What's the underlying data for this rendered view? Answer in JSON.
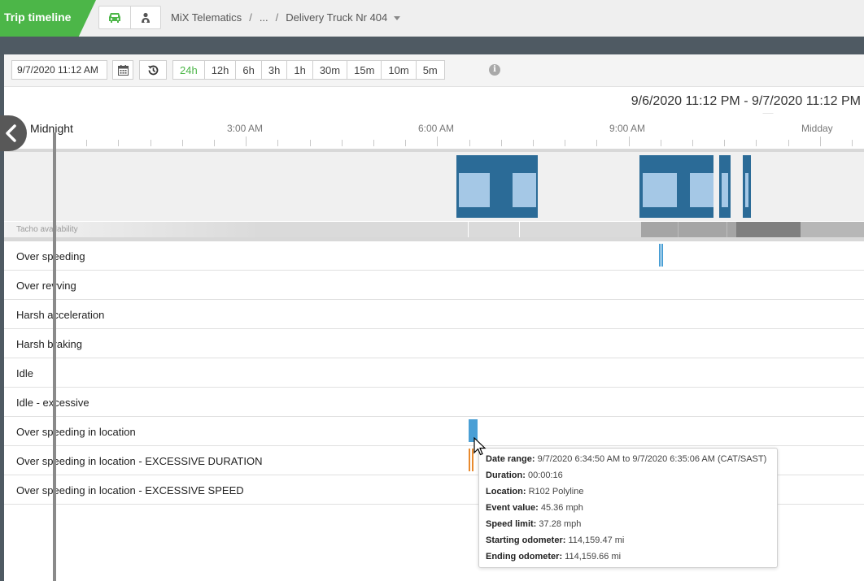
{
  "header": {
    "title": "Trip timeline",
    "modes": [
      {
        "icon": "vehicle-icon",
        "color": "#4cb648"
      },
      {
        "icon": "driver-icon",
        "color": "#555555"
      }
    ],
    "breadcrumb": [
      "MiX Telematics",
      "...",
      "Delivery Truck Nr 404"
    ]
  },
  "toolbar": {
    "date_value": "9/7/2020 11:12 AM",
    "ranges": [
      "24h",
      "12h",
      "6h",
      "3h",
      "1h",
      "30m",
      "15m",
      "10m",
      "5m"
    ],
    "active_range": "24h"
  },
  "range_label": "9/6/2020 11:12 PM  -  9/7/2020 11:12 PM",
  "axis": {
    "start_label": "Midnight",
    "labels": [
      "3:00 AM",
      "6:00 AM",
      "9:00 AM",
      "Midday"
    ]
  },
  "tacho": {
    "label": "Tacho availability"
  },
  "events": {
    "rows": [
      "Over speeding",
      "Over revving",
      "Harsh acceleration",
      "Harsh braking",
      "Idle",
      "Idle - excessive",
      "Over speeding in location",
      "Over speeding in location - EXCESSIVE DURATION",
      "Over speeding in location - EXCESSIVE SPEED"
    ]
  },
  "tooltip": {
    "date_range_label": "Date range:",
    "date_range_value": "9/7/2020 6:34:50 AM to 9/7/2020 6:35:06 AM (CAT/SAST)",
    "duration_label": "Duration:",
    "duration_value": "00:00:16",
    "location_label": "Location:",
    "location_value": "R102 Polyline",
    "event_value_label": "Event value:",
    "event_value_value": "45.36 mph",
    "speed_limit_label": "Speed limit:",
    "speed_limit_value": "37.28 mph",
    "start_odo_label": "Starting odometer:",
    "start_odo_value": "114,159.47 mi",
    "end_odo_label": "Ending odometer:",
    "end_odo_value": "114,159.66 mi"
  },
  "colors": {
    "brand_green": "#4cb648",
    "trip_blue": "#2b6b97",
    "stop_blue": "#a5c8e6",
    "event_blue": "#4a9fd5",
    "event_orange": "#e88a2e"
  }
}
